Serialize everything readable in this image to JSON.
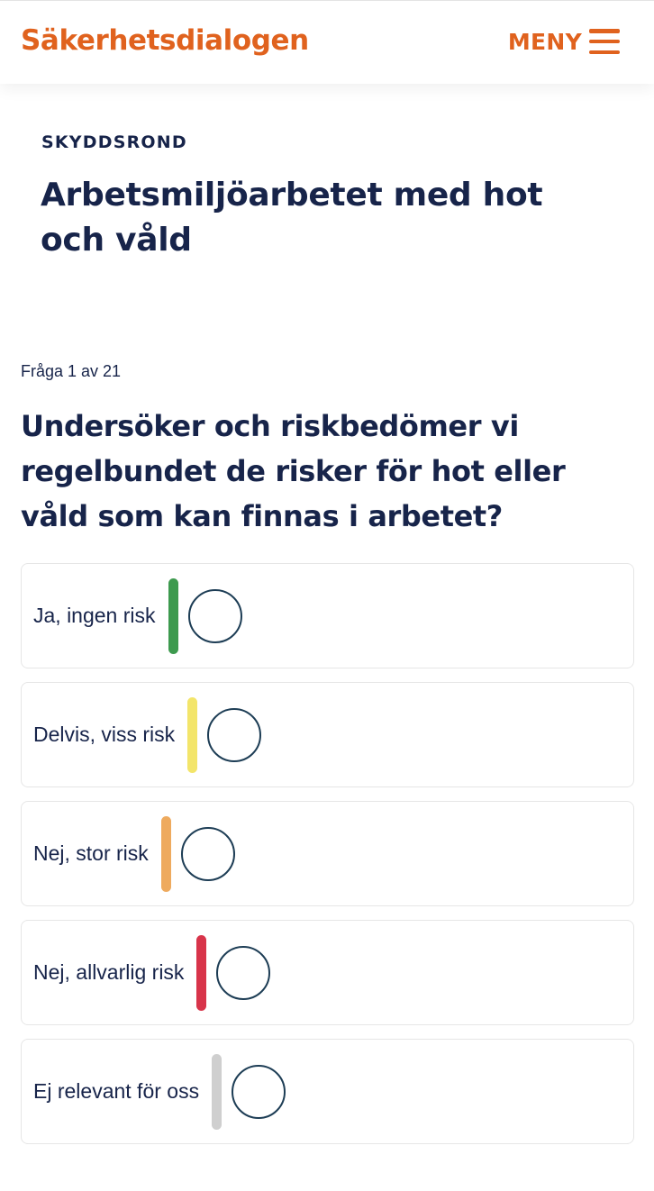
{
  "header": {
    "logo": "Säkerhetsdialogen",
    "menu_label": "MENY",
    "menu_icon": "hamburger-icon"
  },
  "page": {
    "eyebrow": "SKYDDSROND",
    "title": "Arbetsmiljöarbetet med hot och våld"
  },
  "question": {
    "counter": "Fråga 1 av 21",
    "text": "Undersöker och riskbedömer vi regelbundet de risker för hot eller våld som kan finnas i arbetet?"
  },
  "options": [
    {
      "label": "Ja, ingen risk",
      "color": "#3d9a4e"
    },
    {
      "label": "Delvis, viss risk",
      "color": "#f3e56a"
    },
    {
      "label": "Nej, stor risk",
      "color": "#eeaa5e"
    },
    {
      "label": "Nej, allvarlig risk",
      "color": "#d8344a"
    },
    {
      "label": "Ej relevant för oss",
      "color": "#cfcfcf"
    }
  ],
  "colors": {
    "accent": "#e0621e",
    "text": "#17244a",
    "radio_border": "#1d3d55"
  }
}
